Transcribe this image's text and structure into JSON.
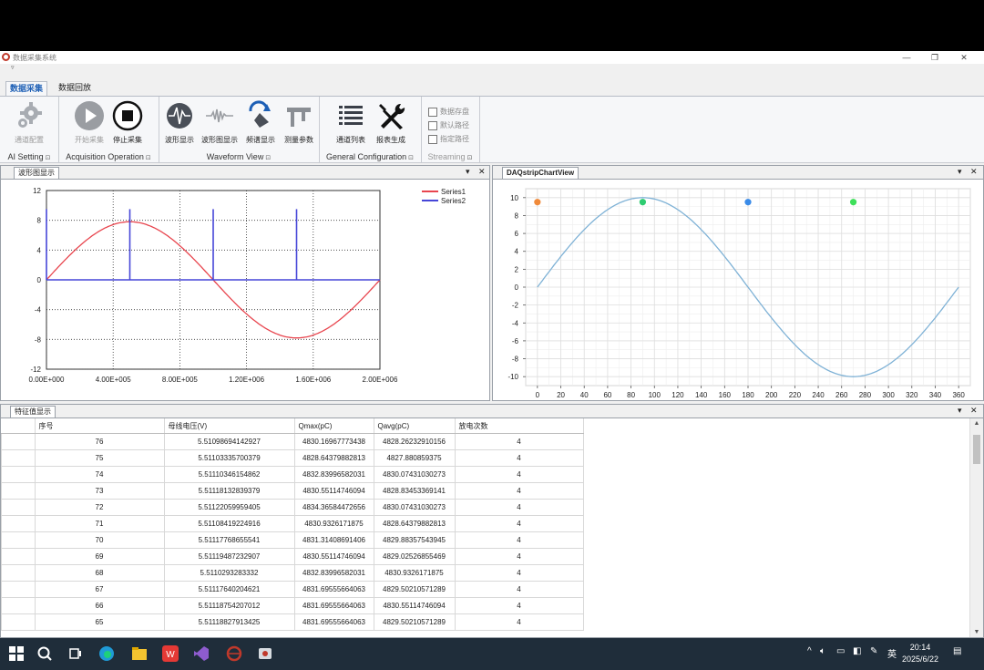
{
  "window": {
    "title": "数据采集系统",
    "controls": {
      "minimize": "—",
      "restore": "❐",
      "close": "✕"
    }
  },
  "ribbon_tabs": [
    {
      "label": "数据采集",
      "active": true
    },
    {
      "label": "数据回放",
      "active": false
    }
  ],
  "ribbon": {
    "ai_setting": {
      "label": "AI Setting",
      "buttons": [
        {
          "label": "通道配置",
          "icon": "gear-icon",
          "disabled": true
        }
      ]
    },
    "acquisition": {
      "label": "Acquisition Operation",
      "buttons": [
        {
          "label": "开始采集",
          "icon": "play-icon",
          "disabled": true
        },
        {
          "label": "停止采集",
          "icon": "stop-icon",
          "disabled": false
        }
      ]
    },
    "waveform": {
      "label": "Waveform View",
      "buttons": [
        {
          "label": "波形显示",
          "icon": "waveform-icon",
          "disabled": false
        },
        {
          "label": "波形图显示",
          "icon": "signal-icon",
          "disabled": false
        },
        {
          "label": "频谱显示",
          "icon": "spectrum-icon",
          "disabled": false
        },
        {
          "label": "测量参数",
          "icon": "caliper-icon",
          "disabled": false
        }
      ]
    },
    "general": {
      "label": "General Configuration",
      "buttons": [
        {
          "label": "通道列表",
          "icon": "list-icon",
          "disabled": false
        },
        {
          "label": "报表生成",
          "icon": "tools-icon",
          "disabled": false
        }
      ]
    },
    "streaming": {
      "label": "Streaming",
      "checkboxes": [
        "数据存盘",
        "默认路径",
        "指定路径"
      ]
    }
  },
  "panels": {
    "waveform_tab": "波形图显示",
    "daq_tab": "DAQstripChartView",
    "feature_tab": "特征值显示",
    "pin_glyph": "▾",
    "close_glyph": "✕"
  },
  "chart_data": [
    {
      "type": "line",
      "xlim": [
        0,
        2000000
      ],
      "ylim": [
        -12,
        12
      ],
      "xticks": [
        0,
        400000,
        800000,
        1200000,
        1600000,
        2000000
      ],
      "xtick_labels": [
        "0.00E+000",
        "4.00E+005",
        "8.00E+005",
        "1.20E+006",
        "1.60E+006",
        "2.00E+006"
      ],
      "yticks": [
        12,
        8,
        4,
        0,
        -4,
        -8,
        -12
      ],
      "ytick_labels": [
        "12",
        "8",
        "4",
        "0",
        "-4",
        "-8",
        "-12"
      ],
      "grid": true,
      "legend": "top-right",
      "series": [
        {
          "name": "Series1",
          "color": "#e8454e",
          "shape": "sine",
          "amplitude": 7.8,
          "period": 2000000
        },
        {
          "name": "Series2",
          "color": "#4646d8",
          "baseline": 0,
          "spikes": [
            {
              "x": 0,
              "y": 9.5
            },
            {
              "x": 500000,
              "y": 9.5
            },
            {
              "x": 1000000,
              "y": 9.5
            },
            {
              "x": 1500000,
              "y": 9.5
            }
          ]
        }
      ]
    },
    {
      "type": "line",
      "xlim": [
        -10,
        370
      ],
      "ylim": [
        -11,
        11
      ],
      "xticks": [
        0,
        20,
        40,
        60,
        80,
        100,
        120,
        140,
        160,
        180,
        200,
        220,
        240,
        260,
        280,
        300,
        320,
        340,
        360
      ],
      "yticks": [
        10,
        8,
        6,
        4,
        2,
        0,
        -2,
        -4,
        -6,
        -8,
        -10
      ],
      "grid": true,
      "series": [
        {
          "color": "#7fb2d6",
          "shape": "sine",
          "amplitude": 10,
          "x_range": [
            0,
            360
          ]
        }
      ],
      "points": [
        {
          "x": 0,
          "y": 9.5,
          "color": "#f08a3a"
        },
        {
          "x": 90,
          "y": 9.5,
          "color": "#2ecc71"
        },
        {
          "x": 180,
          "y": 9.5,
          "color": "#3a8be8"
        },
        {
          "x": 270,
          "y": 9.5,
          "color": "#3ee05a"
        }
      ]
    }
  ],
  "table": {
    "headers": [
      "序号",
      "母线电压(V)",
      "Qmax(pC)",
      "Qavg(pC)",
      "放电次数"
    ],
    "rows": [
      [
        "76",
        "5.51098694142927",
        "4830.16967773438",
        "4828.26232910156",
        "4"
      ],
      [
        "75",
        "5.51103335700379",
        "4828.64379882813",
        "4827.880859375",
        "4"
      ],
      [
        "74",
        "5.51110346154862",
        "4832.83996582031",
        "4830.07431030273",
        "4"
      ],
      [
        "73",
        "5.51118132839379",
        "4830.55114746094",
        "4828.83453369141",
        "4"
      ],
      [
        "72",
        "5.51122059959405",
        "4834.36584472656",
        "4830.07431030273",
        "4"
      ],
      [
        "71",
        "5.51108419224916",
        "4830.9326171875",
        "4828.64379882813",
        "4"
      ],
      [
        "70",
        "5.51117768655541",
        "4831.31408691406",
        "4829.88357543945",
        "4"
      ],
      [
        "69",
        "5.51119487232907",
        "4830.55114746094",
        "4829.02526855469",
        "4"
      ],
      [
        "68",
        "5.5110293283332",
        "4832.83996582031",
        "4830.9326171875",
        "4"
      ],
      [
        "67",
        "5.51117640204621",
        "4831.69555664063",
        "4829.50210571289",
        "4"
      ],
      [
        "66",
        "5.51118754207012",
        "4831.69555664063",
        "4830.55114746094",
        "4"
      ],
      [
        "65",
        "5.51118827913425",
        "4831.69555664063",
        "4829.50210571289",
        "4"
      ]
    ]
  },
  "taskbar": {
    "tray_chevron": "^",
    "ime": "英",
    "time": "20:14",
    "date": "2025/6/22",
    "icons": [
      "windows-icon",
      "search-icon",
      "task-view-icon",
      "edge-icon",
      "file-explorer-icon",
      "wps-icon",
      "visual-studio-icon",
      "app-icon",
      "app2-icon"
    ]
  }
}
